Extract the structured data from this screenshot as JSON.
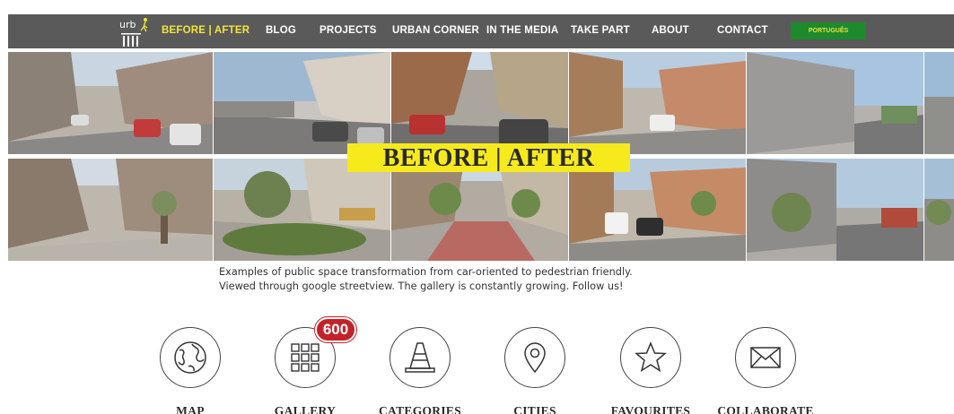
{
  "nav": {
    "items": [
      {
        "label": "BEFORE | AFTER",
        "active": true
      },
      {
        "label": "BLOG",
        "active": false
      },
      {
        "label": "PROJECTS",
        "active": false
      },
      {
        "label": "URBAN CORNER",
        "active": false
      },
      {
        "label": "IN THE MEDIA",
        "active": false
      },
      {
        "label": "TAKE PART",
        "active": false
      },
      {
        "label": "ABOUT",
        "active": false
      },
      {
        "label": "CONTACT",
        "active": false
      }
    ],
    "language_button": "PORTUGUÊS",
    "logo_icon": "urb-i-logo"
  },
  "hero": {
    "title": "BEFORE  |  AFTER",
    "photos_before": [
      "street-photo",
      "street-photo",
      "street-photo",
      "street-photo",
      "street-photo",
      "street-photo"
    ],
    "photos_after": [
      "street-photo",
      "street-photo",
      "street-photo",
      "street-photo",
      "street-photo",
      "street-photo"
    ]
  },
  "intro": {
    "line1": "Examples of public space transformation from car-oriented to pedestrian friendly.",
    "line2": "Viewed through google streetview. The gallery is constantly growing. Follow us!"
  },
  "menu": [
    {
      "label": "MAP",
      "icon": "globe-icon"
    },
    {
      "label": "GALLERY",
      "icon": "grid-icon",
      "badge": "600"
    },
    {
      "label": "CATEGORIES",
      "icon": "traffic-cone-icon"
    },
    {
      "label": "CITIES",
      "icon": "location-pin-icon"
    },
    {
      "label": "FAVOURITES",
      "icon": "star-icon"
    },
    {
      "label": "COLLABORATE",
      "icon": "envelope-icon"
    }
  ],
  "colors": {
    "nav_bg": "#5a5a5a",
    "nav_active": "#f0e63a",
    "lang_bg": "#1d8a2c",
    "title_bg": "#f6ea1d",
    "badge_bg": "#c4222b"
  }
}
